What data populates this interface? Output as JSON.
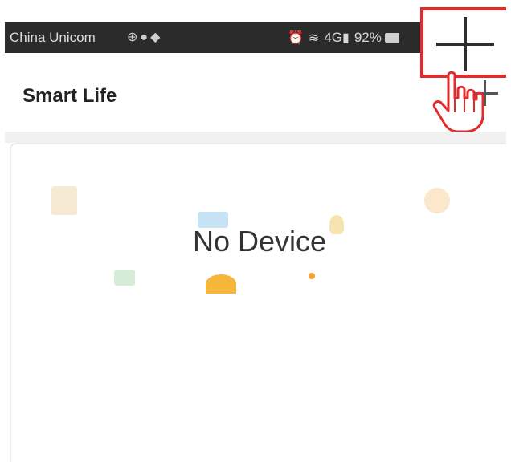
{
  "status_bar": {
    "carrier": "China Unicom",
    "network": "4G",
    "battery": "92%",
    "left_icons": [
      "globe-icon",
      "wechat-icon",
      "notification-icon"
    ],
    "right_icons": [
      "alarm-icon",
      "wifi-icon",
      "signal-icon",
      "battery-icon"
    ]
  },
  "header": {
    "title": "Smart Life",
    "add_button_icon": "plus-icon"
  },
  "callout": {
    "icon": "plus-icon",
    "pointer_icon": "hand-pointer-icon",
    "highlight_color": "#e42b2b"
  },
  "main": {
    "empty_state_text": "No Device"
  }
}
